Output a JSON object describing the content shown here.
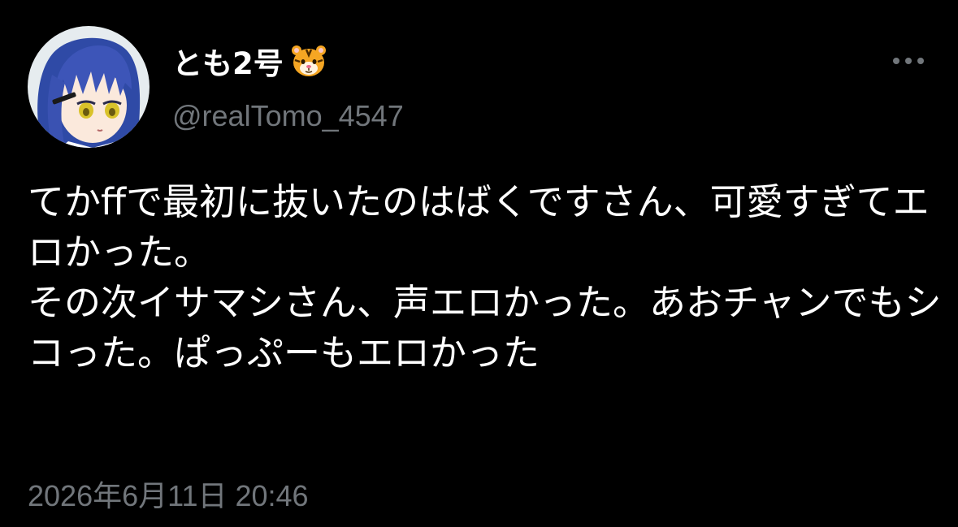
{
  "author": {
    "display_name": "とも2号",
    "name_emoji": "tiger-face-emoji",
    "handle": "@realTomo_4547",
    "avatar": "anime-girl-avatar"
  },
  "tweet": {
    "text": "てかffで最初に抜いたのはばくですさん、可愛すぎてエロかった。\nその次イサマシさん、声エロかった。あおチャンでもシコった。ぱっぷーもエロかった",
    "timestamp": "2026年6月11日 20:46"
  },
  "icons": {
    "more": "more-horizontal-icon"
  },
  "colors": {
    "background": "#000000",
    "primary_text": "#ffffff",
    "secondary_text": "#71767b",
    "avatar_bg": "#e9eef0",
    "avatar_hair": "#3d55b8"
  }
}
